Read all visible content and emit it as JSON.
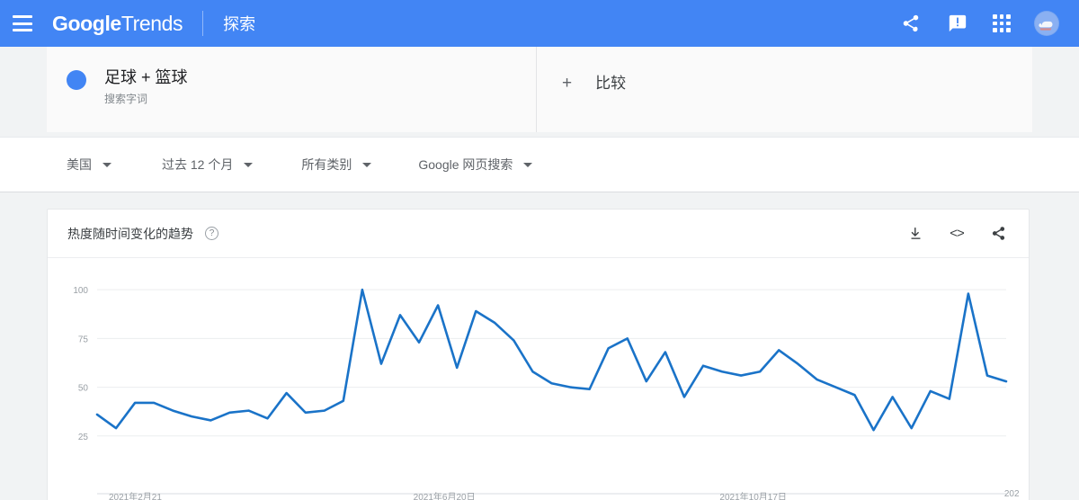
{
  "header": {
    "menu_icon": "hamburger-icon",
    "brand_bold": "Google",
    "brand_light": "Trends",
    "explore": "探索",
    "share_icon": "share-icon",
    "feedback_icon": "feedback-icon",
    "apps_icon": "apps-grid-icon",
    "avatar_icon": "account-avatar-icon",
    "accent": "#4285f4"
  },
  "query": {
    "term": "足球 + 篮球",
    "subtitle": "搜索字词",
    "dot_color": "#4285f4",
    "compare_plus": "+",
    "compare_label": "比较"
  },
  "filters": [
    {
      "label": "美国"
    },
    {
      "label": "过去 12 个月"
    },
    {
      "label": "所有类别"
    },
    {
      "label": "Google 网页搜索"
    }
  ],
  "card": {
    "title": "热度随时间变化的趋势",
    "help": "?",
    "download_icon": "download-icon",
    "embed_icon": "embed-code-icon",
    "embed_glyph": "<>",
    "share_icon": "share-icon"
  },
  "chart_data": {
    "type": "line",
    "title": "热度随时间变化的趋势",
    "xlabel": "",
    "ylabel": "",
    "ylim": [
      0,
      107
    ],
    "yticks": [
      25,
      50,
      75,
      100
    ],
    "ytick_labels": [
      "25",
      "50",
      "75",
      "100"
    ],
    "grid": true,
    "legend": false,
    "line_color": "#1a73c8",
    "xtick_labels": [
      "2021年2月21",
      "2021年6月20日",
      "2021年10月17日",
      "202"
    ],
    "xtick_positions": [
      0,
      0.335,
      0.672,
      0.985
    ],
    "series": [
      {
        "name": "足球 + 篮球",
        "values": [
          36,
          29,
          42,
          42,
          38,
          35,
          33,
          37,
          38,
          34,
          47,
          37,
          38,
          43,
          100,
          62,
          87,
          73,
          92,
          60,
          89,
          83,
          74,
          58,
          52,
          50,
          49,
          70,
          75,
          53,
          68,
          45,
          61,
          58,
          56,
          58,
          69,
          62,
          54,
          50,
          46,
          28,
          45,
          29,
          48,
          44,
          98,
          56,
          53
        ]
      }
    ]
  }
}
